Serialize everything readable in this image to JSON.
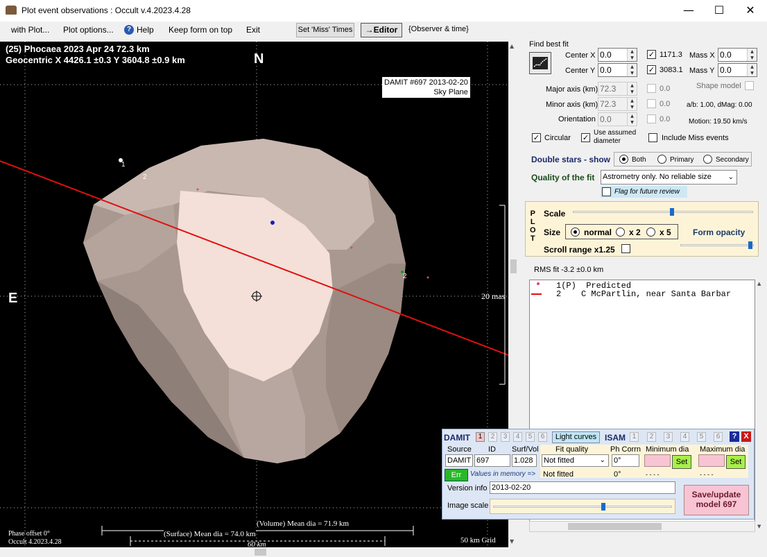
{
  "window": {
    "title": "Plot event observations : Occult v.4.2023.4.28",
    "minimize": "—",
    "maximize": "☐",
    "close": "✕"
  },
  "menu": {
    "with_plot": "with Plot...",
    "plot_options": "Plot options...",
    "help": "Help",
    "keep_on_top": "Keep form on top",
    "exit": "Exit",
    "set_miss_times": "Set 'Miss' Times",
    "editor": "→Editor",
    "observer_time": "{Observer & time}"
  },
  "plot": {
    "header_line1": "(25) Phocaea  2023 Apr 24   72.3 km",
    "header_line2": "Geocentric  X  4426.1 ±0.3  Y 3604.8 ±0.9 km",
    "north": "N",
    "east": "E",
    "damit_label_line1": "DAMIT #697 2013-02-20",
    "damit_label_line2": "Sky Plane",
    "scale_label": "20 mas",
    "chord1_label": "1",
    "chord2_label": "2",
    "chord2b_label": "2",
    "volume_dia": "(Volume) Mean dia = 71.9 km",
    "surface_dia": "(Surface) Mean dia = 74.0 km",
    "km_label": "60 km",
    "phase_offset": "Phase offset 0°",
    "version": "Occult 4.2023.4.28",
    "grid": "50 km Grid"
  },
  "fit": {
    "find_best_fit": "Find best fit",
    "center_x_label": "Center X",
    "center_x": "0.0",
    "center_y_label": "Center Y",
    "center_y": "0.0",
    "val_1171": "1171.3",
    "val_3083": "3083.1",
    "mass_x_label": "Mass X",
    "mass_x": "0.0",
    "mass_y_label": "Mass Y",
    "mass_y": "0.0",
    "major_label": "Major axis (km)",
    "major": "72.3",
    "minor_label": "Minor axis (km)",
    "minor": "72.3",
    "orient_label": "Orientation",
    "orient": "0.0",
    "major_dis": "0.0",
    "minor_dis": "0.0",
    "orient_dis": "0.0",
    "shape_model": "Shape model",
    "ab_dmag": "a/b: 1.00, dMag: 0.00",
    "motion": "Motion: 19.50 km/s",
    "circular": "Circular",
    "use_assumed_1": "Use assumed",
    "use_assumed_2": "diameter",
    "include_miss": "Include Miss events",
    "double_stars": "Double stars - show",
    "both": "Both",
    "primary": "Primary",
    "secondary": "Secondary",
    "quality_label": "Quality of the fit",
    "quality_value": "Astrometry only. No reliable size",
    "flag_review": "Flag for future review"
  },
  "plotbox": {
    "p": "P",
    "l": "L",
    "o": "O",
    "t": "T",
    "scale": "Scale",
    "size": "Size",
    "normal": "normal",
    "x2": "x 2",
    "x5": "x 5",
    "form_opacity": "Form opacity",
    "scroll_range": "Scroll range x1.25",
    "scale_level": 0.55,
    "opacity_level": 0.98
  },
  "rms": "RMS fit -3.2 ±0.0 km",
  "chords": [
    {
      "num": "1(P)",
      "name": "Predicted"
    },
    {
      "num": "2",
      "name": "C McPartlin, near Santa Barbar"
    }
  ],
  "damit": {
    "title": "DAMIT",
    "tabs": [
      "1",
      "2",
      "3",
      "4",
      "5",
      "6"
    ],
    "light_curves": "Light curves",
    "isam": "ISAM",
    "isam_tabs": [
      "1",
      "2",
      "3",
      "4",
      "5",
      "6"
    ],
    "help": "?",
    "close": "X",
    "source_label": "Source",
    "id_label": "ID",
    "surfvol_label": "Surf/Vol",
    "fitq_label": "Fit quality",
    "phcorr_label": "Ph Corrn",
    "mindia_label": "Minimum dia",
    "maxdia_label": "Maximum dia",
    "source": "DAMIT",
    "id": "697",
    "surfvol": "1.028",
    "fitq": "Not fitted",
    "phcorr": "0°",
    "set1": "Set",
    "set2": "Set",
    "err": "Err",
    "values_mem": "Values in memory =>",
    "fitq_mem": "Not fitted",
    "phcorr_mem": "0°",
    "min_mem": "- - - -",
    "max_mem": "- - - -",
    "version_label": "Version info",
    "version": "2013-02-20",
    "image_scale_label": "Image scale",
    "image_scale_level": 0.62,
    "save_1": "Save/update",
    "save_2": "model 697"
  }
}
